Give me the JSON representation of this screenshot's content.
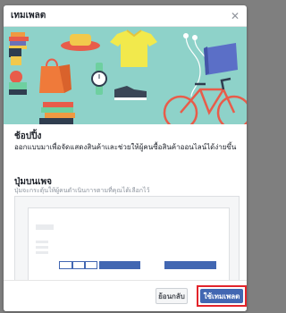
{
  "dialog": {
    "title": "เทมเพลต",
    "close_icon": "close-icon"
  },
  "banner": {
    "colors": {
      "background": "#8ed2c9"
    }
  },
  "section1": {
    "title": "ช้อปปิ้ง",
    "description": "ออกแบบมาเพื่อจัดแสดงสินค้าและช่วยให้ผู้คนซื้อสินค้าออนไลน์ได้ง่ายขึ้น"
  },
  "section2": {
    "title": "ปุ่มบนเพจ",
    "description": "ปุ่มจะกระตุ้นให้ผู้คนดำเนินการตามที่คุณได้เลือกไว้"
  },
  "footer": {
    "back_label": "ย้อนกลับ",
    "use_label": "ใช้เทมเพลต"
  }
}
